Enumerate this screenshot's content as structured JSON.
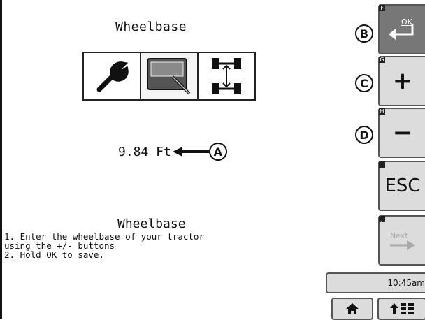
{
  "screen": {
    "title": "Wheelbase",
    "value": "9.84 Ft",
    "callout_a": "A"
  },
  "help": {
    "title": "Wheelbase",
    "body": "1. Enter the wheelbase of your tractor\nusing the +/- buttons\n2. Hold OK to save."
  },
  "tabs": {
    "setup_label": "Setup"
  },
  "sidebar": {
    "ok": {
      "tag": "F",
      "label": "OK",
      "callout": "B"
    },
    "plus": {
      "tag": "G",
      "label": "+",
      "callout": "C"
    },
    "minus": {
      "tag": "H",
      "label": "−",
      "callout": "D"
    },
    "esc": {
      "tag": "I",
      "label": "ESC"
    },
    "next": {
      "tag": "J",
      "label": "Next"
    }
  },
  "status": {
    "time": "10:45am"
  },
  "icons": [
    "wrench-icon",
    "setup-icon",
    "wheelbase-icon",
    "home-icon",
    "menu-icon"
  ]
}
